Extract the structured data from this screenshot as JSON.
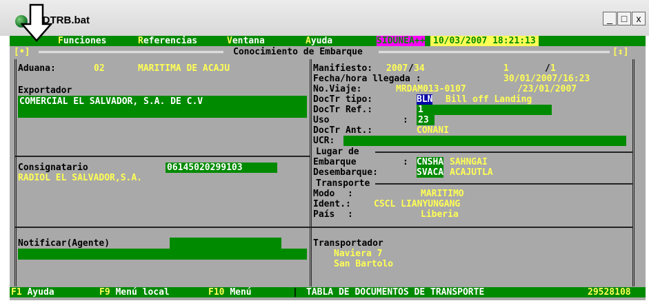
{
  "window": {
    "title": "ODTRB.bat",
    "min_label": "_",
    "max_label": "□",
    "close_label": "x"
  },
  "menubar": {
    "items": [
      {
        "hot": "F",
        "rest": "unciones"
      },
      {
        "hot": "R",
        "rest": "eferencias"
      },
      {
        "hot": "V",
        "rest": "entana"
      },
      {
        "hot": "A",
        "rest": "yuda"
      }
    ],
    "badge": "SIDUNEA++",
    "datetime": "10/03/2007 18:21:13"
  },
  "panel": {
    "title": "Conocimiento de Embarque",
    "left_marker": "[•]",
    "right_marker": "[↕]"
  },
  "aduana": {
    "label": "Aduana:",
    "code": "02",
    "name": "MARITIMA DE ACAJU"
  },
  "exportador": {
    "label": "Exportador",
    "value": "COMERCIAL EL SALVADOR, S.A. DE C.V"
  },
  "consignatario": {
    "label": "Consignatario",
    "nit": "06145020299103",
    "value": "RADIOL EL SALVADOR,S.A."
  },
  "notificar": {
    "label": "Notificar(Agente)",
    "value": ""
  },
  "manifiesto": {
    "label": "Manifiesto:",
    "year": "2007",
    "sep": "/",
    "num": "34",
    "n1": "1",
    "n2": "1"
  },
  "fecha_llegada": {
    "label": "Fecha/hora llegada :",
    "value": "30/01/2007/16:23"
  },
  "no_viaje": {
    "label": "No.Viaje:",
    "value": "MRDAM013-0107",
    "date": "/23/01/2007"
  },
  "doctr_tipo": {
    "label": "DocTr tipo:",
    "code": "BLN",
    "desc": "Bill off Landing"
  },
  "doctr_ref": {
    "label": "DocTr Ref.:",
    "value": "1"
  },
  "uso": {
    "label": "Uso",
    "colon": ":",
    "value": "23"
  },
  "doctr_ant": {
    "label": "DocTr Ant.:",
    "value": "CONANI"
  },
  "ucr": {
    "label": "UCR:",
    "value": ""
  },
  "lugar": {
    "title": "Lugar de",
    "embarque_label": "Embarque",
    "embarque_code": "CNSHA",
    "embarque_name": "SAHNGAI",
    "desembarque_label": "Desembarque:",
    "desembarque_code": "SVACA",
    "desembarque_name": "ACAJUTLA"
  },
  "transporte": {
    "title": "Transporte",
    "modo_label": "Modo",
    "modo_value": "MARITIMO",
    "ident_label": "Ident.:",
    "ident_value": "CSCL LIANYUNGANG",
    "pais_label": "País",
    "pais_value": "Liberia"
  },
  "transportador": {
    "label": "Transportador",
    "line1": "Naviera 7",
    "line2": "San Bartolo"
  },
  "statusbar": {
    "f1_key": "F1",
    "f1_label": "Ayuda",
    "f9_key": "F9",
    "f9_label": "Menú local",
    "f10_key": "F10",
    "f10_label": "Menú",
    "table_label": "TABLA DE DOCUMENTOS DE TRANSPORTE",
    "code": "29528108"
  },
  "colors": {
    "terminal_bg": "#a9a9a9",
    "field_green": "#008a00",
    "value_yellow": "#ffff55",
    "badge_magenta": "#ff00ff",
    "code_blue": "#0000a8"
  }
}
